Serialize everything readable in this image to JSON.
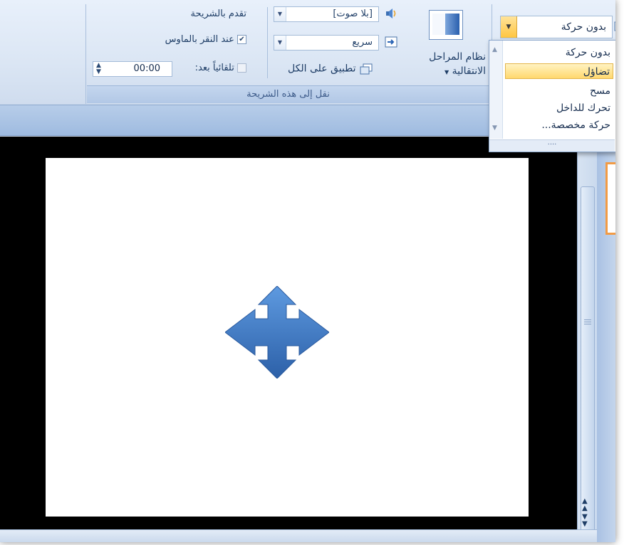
{
  "ribbon": {
    "group_caption": "نقل إلى هذه الشريحة",
    "advance_title": "تقدم بالشريحة",
    "on_click": {
      "label": "عند النقر بالماوس",
      "checked": true
    },
    "auto_after": {
      "label": "تلقائياً بعد:",
      "checked": false,
      "value": "00:00"
    },
    "sound_combo": "[بلا صوت]",
    "speed_combo": "سريع",
    "apply_all": "تطبيق على الكل",
    "transition_scheme": {
      "line1": "نظام المراحل",
      "line2": "الانتقالية"
    },
    "animation_combo": "بدون حركة"
  },
  "dropdown": {
    "items": [
      "بدون حركة",
      "تضاؤل",
      "مسح",
      "تحرك للداخل",
      "حركة مخصصة..."
    ],
    "selected_index": 1
  },
  "colors": {
    "accent": "#ffd86e",
    "shape": "#3d7ac8",
    "ribbon": "#dbe6f4"
  }
}
